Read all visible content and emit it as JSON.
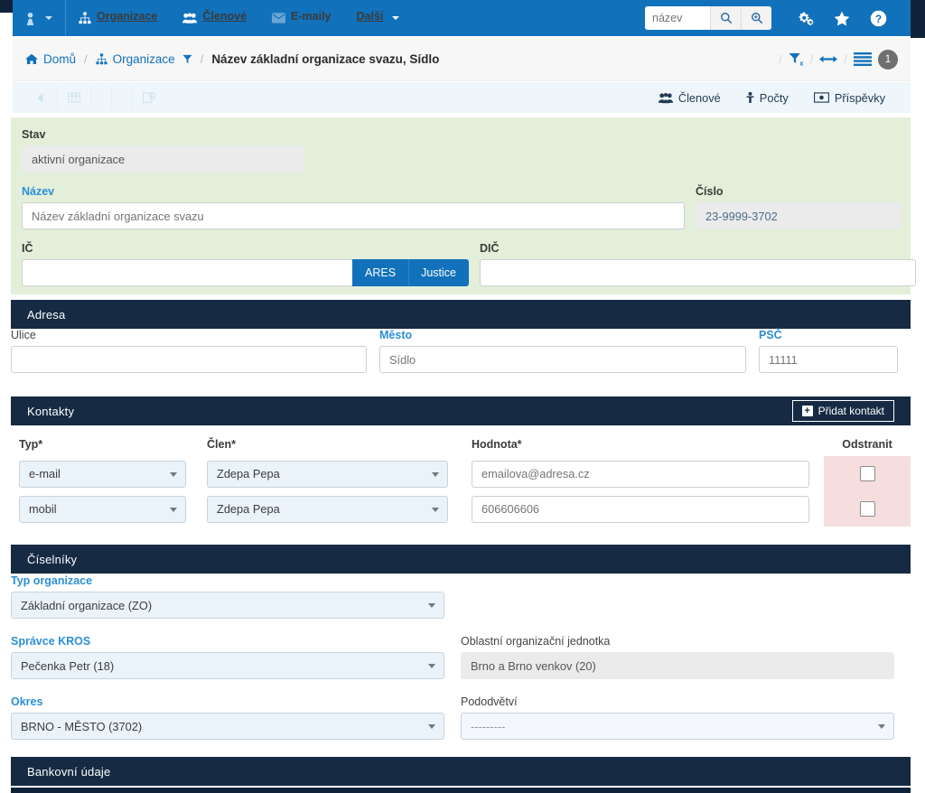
{
  "navbar": {
    "user_icon": "user-tie-icon",
    "items": [
      {
        "label": "Organizace",
        "icon": "sitemap-icon",
        "state": "enabled"
      },
      {
        "label": "Členové",
        "icon": "users-icon",
        "state": "enabled"
      },
      {
        "label": "E-maily",
        "icon": "envelope-icon",
        "state": "disabled"
      },
      {
        "label": "Další",
        "icon": "",
        "state": "enabled",
        "caret": true
      }
    ],
    "search": {
      "value": "název",
      "placeholder": "název"
    },
    "search_icon": "search-icon",
    "search_advanced_icon": "search-plus-icon",
    "right_icons": [
      {
        "name": "cogs-icon"
      },
      {
        "name": "star-icon"
      },
      {
        "name": "question-circle-icon"
      }
    ]
  },
  "breadcrumb": {
    "home": "Domů",
    "home_icon": "home-icon",
    "section": "Organizace",
    "section_icon": "sitemap-icon",
    "section_filter_icon": "filter-icon",
    "current": "Název základní organizace svazu, Sídlo",
    "tools": [
      {
        "name": "filter-remove-icon"
      },
      {
        "name": "arrows-horizontal-icon"
      },
      {
        "name": "list-lines-icon"
      }
    ],
    "count_badge": "1"
  },
  "ghost_toolbar": {
    "left_buttons": [
      {
        "label": "",
        "icon": "back-icon"
      },
      {
        "label": "",
        "icon": "table-icon"
      },
      {
        "label": "",
        "icon": "blank-icon"
      },
      {
        "label": "",
        "icon": "blank2-icon"
      },
      {
        "label": "",
        "icon": "search-doc-icon"
      }
    ],
    "actions": [
      {
        "label": "Členové",
        "icon": "users-icon"
      },
      {
        "label": "Počty",
        "icon": "person-count-icon"
      },
      {
        "label": "Příspěvky",
        "icon": "money-icon"
      }
    ]
  },
  "form": {
    "stav": {
      "label": "Stav",
      "value": "aktivní organizace"
    },
    "nazev": {
      "label": "Název",
      "value": "Název základní organizace svazu",
      "placeholder": "Název základní organizace svazu"
    },
    "cislo": {
      "label": "Číslo",
      "value": "23-9999-3702"
    },
    "ic": {
      "label": "IČ",
      "value": "",
      "placeholder": ""
    },
    "ares_button": "ARES",
    "justice_button": "Justice",
    "dic": {
      "label": "DIČ",
      "value": "",
      "placeholder": ""
    }
  },
  "adresa": {
    "title": "Adresa",
    "ulice": {
      "label": "Ulice",
      "value": "",
      "placeholder": ""
    },
    "mesto": {
      "label": "Město",
      "value": "Sídlo",
      "placeholder": "Sídlo"
    },
    "psc": {
      "label": "PSČ",
      "value": "11111",
      "placeholder": "11111"
    }
  },
  "kontakty": {
    "title": "Kontakty",
    "add_button": "Přidat kontakt",
    "columns": [
      "Typ*",
      "Člen*",
      "Hodnota*",
      "Odstranit"
    ],
    "rows": [
      {
        "typ": "e-mail",
        "clen": "Zdepa Pepa",
        "hodnota": "emailova@adresa.cz",
        "odstranit": false
      },
      {
        "typ": "mobil",
        "clen": "Zdepa Pepa",
        "hodnota": "606606606",
        "odstranit": false
      }
    ]
  },
  "ciselniky": {
    "title": "Číselníky",
    "typ_organizace": {
      "label": "Typ organizace",
      "value": "Základní organizace (ZO)"
    },
    "spravce_kros": {
      "label": "Správce KROS",
      "value": "Pečenka Petr (18)"
    },
    "oblastni_jednotka": {
      "label": "Oblastní organizační jednotka",
      "value": "Brno a Brno venkov (20)"
    },
    "okres": {
      "label": "Okres",
      "value": "BRNO - MĚSTO (3702)"
    },
    "pododvetvi": {
      "label": "Pododvětví",
      "value": "---------"
    }
  },
  "bankovni": {
    "title": "Bankovní údaje"
  },
  "colors": {
    "navbar_blue": "#1271bb",
    "section_dark": "#162a43",
    "panel_green": "#e3efd9",
    "label_blue": "#2b8fd6",
    "delete_pink": "#f7dede",
    "select_blue": "#eaf2fa"
  }
}
